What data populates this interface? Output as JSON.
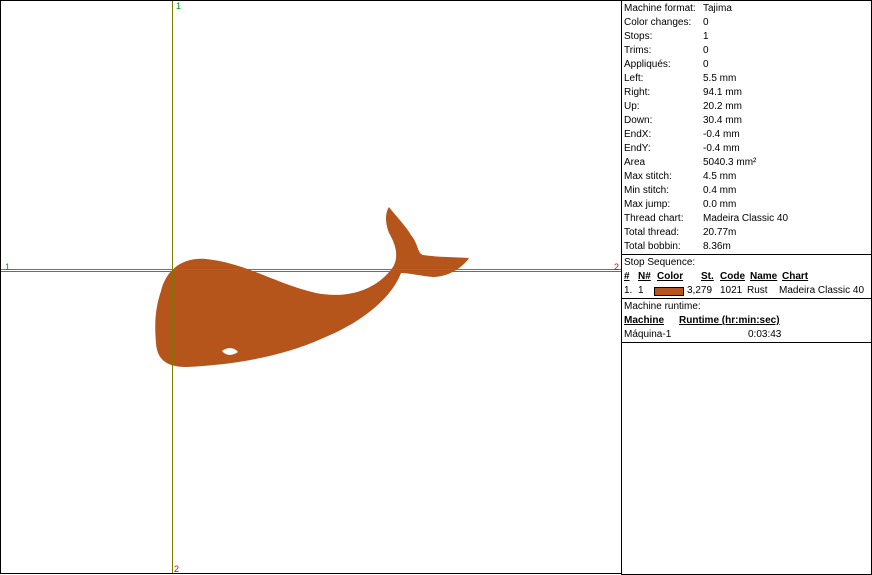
{
  "axis_labels": {
    "top": "1",
    "left": "1",
    "right": "2",
    "bottom": "2"
  },
  "stats": [
    {
      "label": "Machine format:",
      "value": "Tajima"
    },
    {
      "label": "Color changes:",
      "value": "0"
    },
    {
      "label": "Stops:",
      "value": "1"
    },
    {
      "label": "Trims:",
      "value": "0"
    },
    {
      "label": "Appliqués:",
      "value": "0"
    },
    {
      "label": "Left:",
      "value": "5.5 mm"
    },
    {
      "label": "Right:",
      "value": "94.1 mm"
    },
    {
      "label": "Up:",
      "value": "20.2 mm"
    },
    {
      "label": "Down:",
      "value": "30.4 mm"
    },
    {
      "label": "EndX:",
      "value": "-0.4 mm"
    },
    {
      "label": "EndY:",
      "value": "-0.4 mm"
    },
    {
      "label": "Area",
      "value": "5040.3 mm²"
    },
    {
      "label": "Max stitch:",
      "value": "4.5 mm"
    },
    {
      "label": "Min stitch:",
      "value": "0.4 mm"
    },
    {
      "label": "Max jump:",
      "value": "0.0 mm"
    },
    {
      "label": "Thread chart:",
      "value": "Madeira Classic 40"
    },
    {
      "label": "Total thread:",
      "value": "20.77m"
    },
    {
      "label": "Total bobbin:",
      "value": "8.36m"
    }
  ],
  "stop_sequence": {
    "title": "Stop Sequence:",
    "headers": {
      "num": "#",
      "n": "N#",
      "color": "Color",
      "st": "St.",
      "code": "Code",
      "name": "Name",
      "chart": "Chart"
    },
    "row": {
      "num": "1.",
      "n": "1",
      "color_hex": "#b5541b",
      "st": "3,279",
      "code": "1021",
      "name": "Rust",
      "chart": "Madeira Classic 40"
    }
  },
  "runtime": {
    "title": "Machine runtime:",
    "headers": {
      "machine": "Machine",
      "runtime": "Runtime (hr:min:sec)"
    },
    "row": {
      "machine": "Máquina-1",
      "runtime": "0:03:43"
    }
  },
  "colors": {
    "thread": "#b5541b"
  }
}
